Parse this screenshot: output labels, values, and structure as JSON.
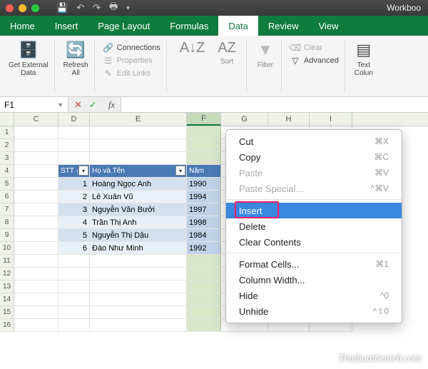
{
  "titlebar": {
    "doc": "Workboo"
  },
  "tabs": [
    "Home",
    "Insert",
    "Page Layout",
    "Formulas",
    "Data",
    "Review",
    "View"
  ],
  "active_tab": "Data",
  "ribbon": {
    "getdata": "Get External\nData",
    "refresh": "Refresh\nAll",
    "conn": "Connections",
    "props": "Properties",
    "links": "Edit Links",
    "sort": "Sort",
    "filter": "Filter",
    "clear": "Clear",
    "advanced": "Advanced",
    "textcol": "Text\nColun"
  },
  "namebox": "F1",
  "columns": [
    "C",
    "D",
    "E",
    "F",
    "G",
    "H",
    "I"
  ],
  "rownums": [
    1,
    2,
    3,
    4,
    5,
    6,
    7,
    8,
    9,
    10,
    11,
    12,
    13,
    14,
    15,
    16
  ],
  "table": {
    "headers": {
      "stt": "STT",
      "hoten": "Họ và Tên",
      "nam": "Năm"
    },
    "rows": [
      {
        "stt": 1,
        "name": "Hoàng Ngọc Anh",
        "nam": 1990
      },
      {
        "stt": 2,
        "name": "Lê Xuân Vũ",
        "nam": 1994
      },
      {
        "stt": 3,
        "name": "Nguyễn Văn Bưởi",
        "nam": 1997
      },
      {
        "stt": 4,
        "name": "Trần Thị Anh",
        "nam": 1998
      },
      {
        "stt": 5,
        "name": "Nguyễn Thị Dậu",
        "nam": 1984
      },
      {
        "stt": 6,
        "name": "Đào Như Minh",
        "nam": 1992
      }
    ]
  },
  "ctx": {
    "cut": "Cut",
    "cut_sc": "⌘X",
    "copy": "Copy",
    "copy_sc": "⌘C",
    "paste": "Paste",
    "paste_sc": "⌘V",
    "pastesp": "Paste Special...",
    "pastesp_sc": "^⌘V",
    "insert": "Insert",
    "delete": "Delete",
    "clear": "Clear Contents",
    "fmt": "Format Cells...",
    "fmt_sc": "⌘1",
    "colw": "Column Width...",
    "hide": "Hide",
    "hide_sc": "^0",
    "unhide": "Unhide",
    "unhide_sc": "^⇧0"
  },
  "watermark": "Thuthuattienich.com"
}
